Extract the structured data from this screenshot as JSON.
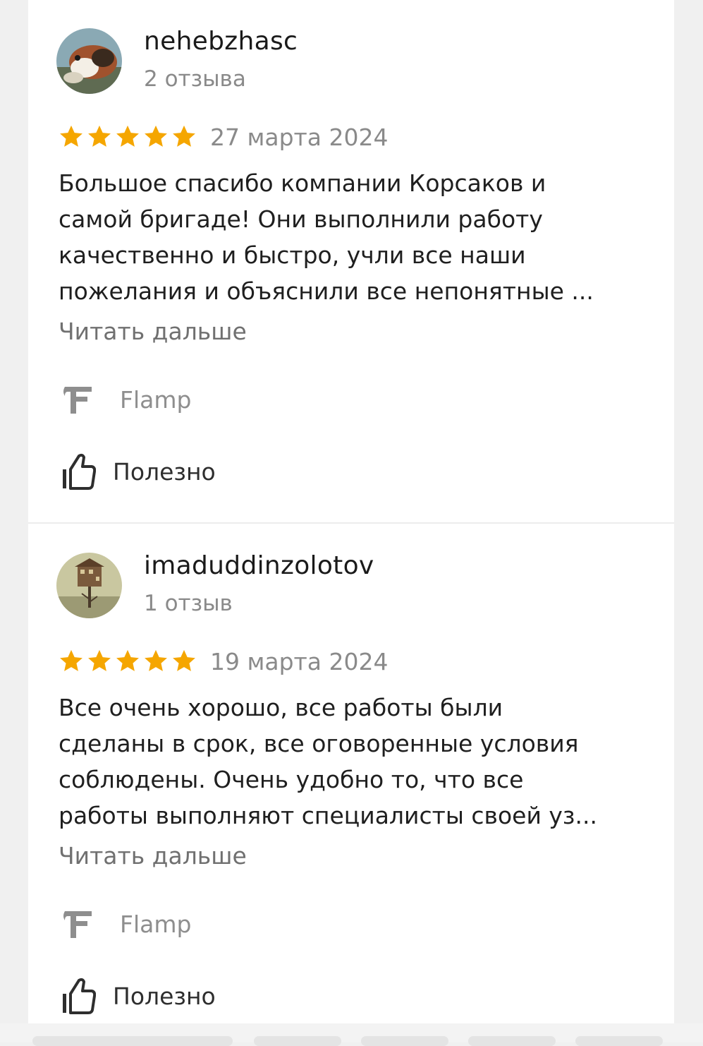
{
  "reviews": [
    {
      "author": "nehebzhasc",
      "review_count": "2 отзыва",
      "rating": 5,
      "date": "27 марта 2024",
      "text_lines": [
        "Большое спасибо компании Корсаков и",
        "самой бригаде! Они выполнили работу",
        "качественно и быстро, учли все наши",
        "пожелания и объяснили все непонятные ..."
      ],
      "read_more": "Читать дальше",
      "source": "Flamp",
      "helpful": "Полезно"
    },
    {
      "author": "imaduddinzolotov",
      "review_count": "1 отзыв",
      "rating": 5,
      "date": "19 марта 2024",
      "text_lines": [
        "Все очень хорошо, все работы были",
        "сделаны в срок, все оговоренные условия",
        "соблюдены. Очень удобно то, что все",
        "работы выполняют специалисты своей уз..."
      ],
      "read_more": "Читать дальше",
      "source": "Flamp",
      "helpful": "Полезно"
    }
  ],
  "colors": {
    "star": "#f5a600",
    "text": "#1f1f1f",
    "muted": "#8a8a8a"
  },
  "icons": {
    "source": "flamp-logo-icon",
    "helpful": "thumbs-up-icon",
    "rating": "star-icon"
  }
}
